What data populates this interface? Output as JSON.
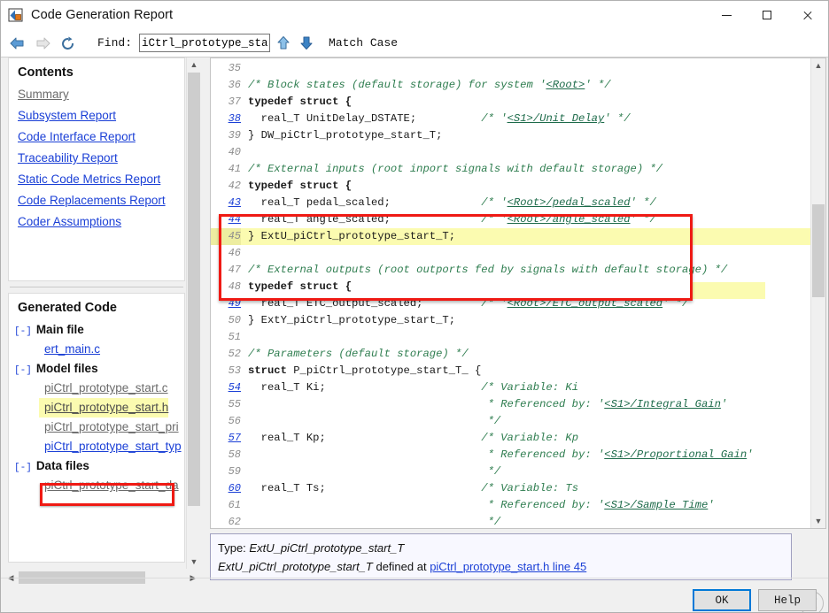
{
  "window": {
    "title": "Code Generation Report",
    "icon": "matlab-report-icon",
    "minimize_label": "Minimize",
    "maximize_label": "Maximize",
    "close_label": "Close"
  },
  "toolbar": {
    "back_label": "Back",
    "forward_label": "Forward",
    "reload_label": "Reload",
    "find_label": "Find:",
    "find_value": "iCtrl_prototype_star_T",
    "find_placeholder": "Find:",
    "find_prev_label": "Find Previous",
    "find_next_label": "Find Next",
    "match_case_label": "Match Case"
  },
  "sidebar": {
    "contents_heading": "Contents",
    "contents_links": [
      {
        "label": "Summary",
        "state": "visited"
      },
      {
        "label": "Subsystem Report",
        "state": "link"
      },
      {
        "label": "Code Interface Report",
        "state": "link"
      },
      {
        "label": "Traceability Report",
        "state": "link"
      },
      {
        "label": "Static Code Metrics Report",
        "state": "link"
      },
      {
        "label": "Code Replacements Report",
        "state": "link"
      },
      {
        "label": "Coder Assumptions",
        "state": "link"
      }
    ],
    "generated_code_heading": "Generated Code",
    "tree": [
      {
        "toggle": "[-]",
        "group": "Main file",
        "files": [
          {
            "label": "ert_main.c",
            "state": "link",
            "selected": false
          }
        ]
      },
      {
        "toggle": "[-]",
        "group": "Model files",
        "files": [
          {
            "label": "piCtrl_prototype_start.c",
            "state": "visited",
            "selected": false
          },
          {
            "label": "piCtrl_prototype_start.h",
            "state": "visited",
            "selected": true
          },
          {
            "label": "piCtrl_prototype_start_pri",
            "state": "visited",
            "selected": false
          },
          {
            "label": "piCtrl_prototype_start_typ",
            "state": "link",
            "selected": false
          }
        ]
      },
      {
        "toggle": "[-]",
        "group": "Data files",
        "files": [
          {
            "label": "piCtrl_prototype_start_da",
            "state": "visited",
            "selected": false
          }
        ]
      }
    ],
    "scroll_up_label": "Scroll up",
    "scroll_down_label": "Scroll down",
    "scroll_left_label": "Scroll left",
    "scroll_right_label": "Scroll right"
  },
  "code": {
    "scroll_up_label": "Scroll up",
    "scroll_down_label": "Scroll down",
    "lines": [
      {
        "n": "35",
        "link": false,
        "hl": false,
        "parts": []
      },
      {
        "n": "36",
        "link": false,
        "hl": false,
        "parts": [
          {
            "t": "/* Block states (default storage) for system '",
            "c": "cm"
          },
          {
            "t": "<Root>",
            "c": "cml"
          },
          {
            "t": "' */",
            "c": "cm"
          }
        ]
      },
      {
        "n": "37",
        "link": false,
        "hl": false,
        "parts": [
          {
            "t": "typedef struct {",
            "c": "kw"
          }
        ]
      },
      {
        "n": "38",
        "link": true,
        "hl": false,
        "parts": [
          {
            "t": "  real_T UnitDelay_DSTATE;          ",
            "c": ""
          },
          {
            "t": "/* '",
            "c": "cm"
          },
          {
            "t": "<S1>/Unit Delay",
            "c": "cml"
          },
          {
            "t": "' */",
            "c": "cm"
          }
        ]
      },
      {
        "n": "39",
        "link": false,
        "hl": false,
        "parts": [
          {
            "t": "} DW_piCtrl_prototype_start_T;",
            "c": ""
          }
        ]
      },
      {
        "n": "40",
        "link": false,
        "hl": false,
        "parts": []
      },
      {
        "n": "41",
        "link": false,
        "hl": false,
        "parts": [
          {
            "t": "/* External inputs (root inport signals with default storage) */",
            "c": "cm"
          }
        ]
      },
      {
        "n": "42",
        "link": false,
        "hl": false,
        "parts": [
          {
            "t": "typedef struct {",
            "c": "kw"
          }
        ]
      },
      {
        "n": "43",
        "link": true,
        "hl": false,
        "parts": [
          {
            "t": "  real_T pedal_scaled;              ",
            "c": ""
          },
          {
            "t": "/* '",
            "c": "cm"
          },
          {
            "t": "<Root>/pedal_scaled",
            "c": "cml"
          },
          {
            "t": "' */",
            "c": "cm"
          }
        ]
      },
      {
        "n": "44",
        "link": true,
        "hl": false,
        "parts": [
          {
            "t": "  real_T angle_scaled;              ",
            "c": ""
          },
          {
            "t": "/* '",
            "c": "cm"
          },
          {
            "t": "<Root>/angle_scaled",
            "c": "cml"
          },
          {
            "t": "' */",
            "c": "cm"
          }
        ]
      },
      {
        "n": "45",
        "link": false,
        "hl": true,
        "parts": [
          {
            "t": "} ExtU_piCtrl_prototype_start_T;",
            "c": ""
          }
        ]
      },
      {
        "n": "46",
        "link": false,
        "hl": false,
        "parts": []
      },
      {
        "n": "47",
        "link": false,
        "hl": false,
        "parts": [
          {
            "t": "/* External outputs (root outports fed by signals with default storage) */",
            "c": "cm"
          }
        ]
      },
      {
        "n": "48",
        "link": false,
        "hl": false,
        "parts": [
          {
            "t": "typedef struct {",
            "c": "kw"
          }
        ]
      },
      {
        "n": "49",
        "link": true,
        "hl": false,
        "parts": [
          {
            "t": "  real_T ETC_output_scaled;         ",
            "c": ""
          },
          {
            "t": "/* '",
            "c": "cm"
          },
          {
            "t": "<Root>/ETC_output_scaled",
            "c": "cml"
          },
          {
            "t": "' */",
            "c": "cm"
          }
        ]
      },
      {
        "n": "50",
        "link": false,
        "hl": false,
        "parts": [
          {
            "t": "} ExtY_piCtrl_prototype_start_T;",
            "c": ""
          }
        ]
      },
      {
        "n": "51",
        "link": false,
        "hl": false,
        "parts": []
      },
      {
        "n": "52",
        "link": false,
        "hl": false,
        "parts": [
          {
            "t": "/* Parameters (default storage) */",
            "c": "cm"
          }
        ]
      },
      {
        "n": "53",
        "link": false,
        "hl": false,
        "parts": [
          {
            "t": "struct",
            "c": "kw"
          },
          {
            "t": " P_piCtrl_prototype_start_T_ {",
            "c": ""
          }
        ]
      },
      {
        "n": "54",
        "link": true,
        "hl": false,
        "parts": [
          {
            "t": "  real_T Ki;                        ",
            "c": ""
          },
          {
            "t": "/* Variable: Ki",
            "c": "cm"
          }
        ]
      },
      {
        "n": "55",
        "link": false,
        "hl": false,
        "parts": [
          {
            "t": "                                     ",
            "c": ""
          },
          {
            "t": "* Referenced by: '",
            "c": "cm"
          },
          {
            "t": "<S1>/Integral Gain",
            "c": "cml"
          },
          {
            "t": "'",
            "c": "cm"
          }
        ]
      },
      {
        "n": "56",
        "link": false,
        "hl": false,
        "parts": [
          {
            "t": "                                     ",
            "c": ""
          },
          {
            "t": "*/",
            "c": "cm"
          }
        ]
      },
      {
        "n": "57",
        "link": true,
        "hl": false,
        "parts": [
          {
            "t": "  real_T Kp;                        ",
            "c": ""
          },
          {
            "t": "/* Variable: Kp",
            "c": "cm"
          }
        ]
      },
      {
        "n": "58",
        "link": false,
        "hl": false,
        "parts": [
          {
            "t": "                                     ",
            "c": ""
          },
          {
            "t": "* Referenced by: '",
            "c": "cm"
          },
          {
            "t": "<S1>/Proportional Gain",
            "c": "cml"
          },
          {
            "t": "'",
            "c": "cm"
          }
        ]
      },
      {
        "n": "59",
        "link": false,
        "hl": false,
        "parts": [
          {
            "t": "                                     ",
            "c": ""
          },
          {
            "t": "*/",
            "c": "cm"
          }
        ]
      },
      {
        "n": "60",
        "link": true,
        "hl": false,
        "parts": [
          {
            "t": "  real_T Ts;                        ",
            "c": ""
          },
          {
            "t": "/* Variable: Ts",
            "c": "cm"
          }
        ]
      },
      {
        "n": "61",
        "link": false,
        "hl": false,
        "parts": [
          {
            "t": "                                     ",
            "c": ""
          },
          {
            "t": "* Referenced by: '",
            "c": "cm"
          },
          {
            "t": "<S1>/Sample Time",
            "c": "cml"
          },
          {
            "t": "'",
            "c": "cm"
          }
        ]
      },
      {
        "n": "62",
        "link": false,
        "hl": false,
        "parts": [
          {
            "t": "                                     ",
            "c": ""
          },
          {
            "t": "*/",
            "c": "cm"
          }
        ]
      }
    ]
  },
  "info": {
    "line1_prefix": "Type: ",
    "line1_type": "ExtU_piCtrl_prototype_start_T",
    "line2_type": "ExtU_piCtrl_prototype_start_T",
    "line2_mid": " defined at ",
    "line2_link": "piCtrl_prototype_start.h line 45",
    "close_label": "x"
  },
  "buttons": {
    "ok_label": "OK",
    "help_label": "Help"
  },
  "colors": {
    "link": "#1a3fd6",
    "visited": "#6b6b6b",
    "comment": "#2e7d4f",
    "highlight": "#fbfbb0",
    "annotation_red": "#ef1a14",
    "focus_blue": "#0078d7"
  }
}
